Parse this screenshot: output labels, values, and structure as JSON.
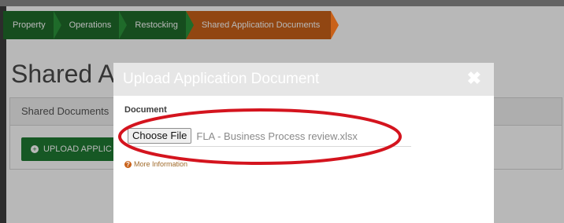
{
  "breadcrumb": {
    "items": [
      {
        "label": "Property"
      },
      {
        "label": "Operations"
      },
      {
        "label": "Restocking"
      },
      {
        "label": "Shared Application Documents"
      }
    ]
  },
  "page": {
    "title": "Shared Ap",
    "panel_header": "Shared Documents",
    "upload_button_label": "UPLOAD APPLIC"
  },
  "modal": {
    "title": "Upload Application Document",
    "close_icon": "close-icon",
    "field_label": "Document",
    "choose_button_label": "Choose File",
    "file_name": "FLA - Business Process review.xlsx",
    "more_info_label": "More Information"
  },
  "colors": {
    "breadcrumb_green": "#1f6b2a",
    "breadcrumb_active": "#c9621a",
    "button_green": "#1f7a33",
    "annotation_red": "#d4141e"
  }
}
